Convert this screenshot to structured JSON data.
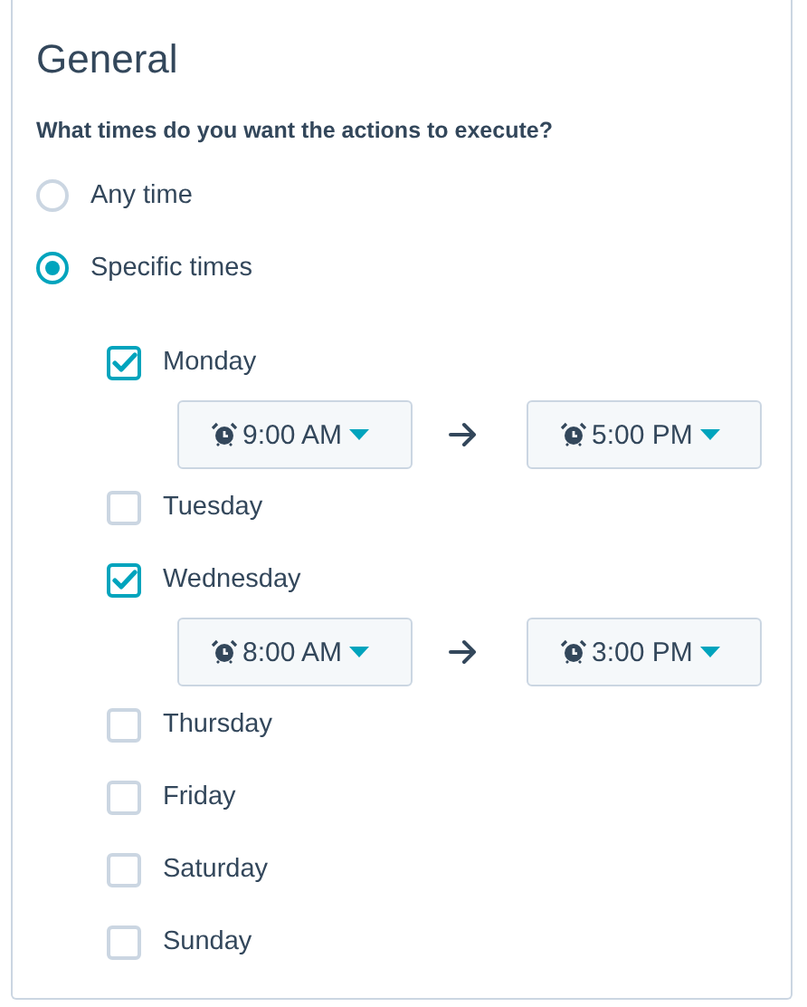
{
  "title": "General",
  "question": "What times do you want the actions to execute?",
  "options": [
    {
      "label": "Any time",
      "selected": false
    },
    {
      "label": "Specific times",
      "selected": true
    }
  ],
  "days": [
    {
      "label": "Monday",
      "checked": true,
      "start": "9:00 AM",
      "end": "5:00 PM"
    },
    {
      "label": "Tuesday",
      "checked": false
    },
    {
      "label": "Wednesday",
      "checked": true,
      "start": "8:00 AM",
      "end": "3:00 PM"
    },
    {
      "label": "Thursday",
      "checked": false
    },
    {
      "label": "Friday",
      "checked": false
    },
    {
      "label": "Saturday",
      "checked": false
    },
    {
      "label": "Sunday",
      "checked": false
    }
  ]
}
